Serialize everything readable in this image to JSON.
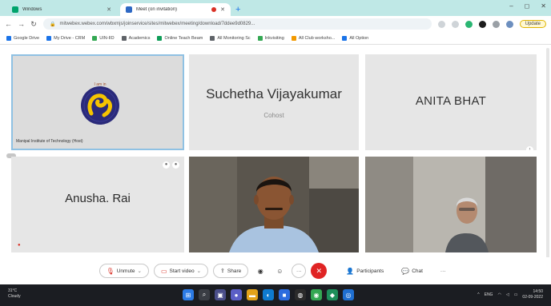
{
  "browser": {
    "tabs": [
      {
        "title": "Windows",
        "active": false,
        "fav_color": "#00a36c"
      },
      {
        "title": "Meet (on invitation)",
        "active": true,
        "fav_color": "#2d68c4"
      }
    ],
    "new_tab": "+",
    "window_controls": [
      "–",
      "◻",
      "✕"
    ],
    "url": "mitwebex.webex.com/wbxmjs/joinservice/sites/mitwebex/meeting/download/7ddee9d0829...",
    "update_label": "Update",
    "bookmarks": [
      {
        "label": "Google Drive",
        "color": "#1a73e8"
      },
      {
        "label": "My Drive - CRM",
        "color": "#1a73e8"
      },
      {
        "label": "UIN-IID",
        "color": "#34a853"
      },
      {
        "label": "Academics",
        "color": "#5f6368"
      },
      {
        "label": "Online Teach Beam",
        "color": "#0f9d58"
      },
      {
        "label": "All Monitoring Sc",
        "color": "#5f6368"
      },
      {
        "label": "Inkvisiting",
        "color": "#34a853"
      },
      {
        "label": "All Club worksho...",
        "color": "#f29900"
      },
      {
        "label": "All Option",
        "color": "#1a73e8"
      }
    ]
  },
  "meeting": {
    "participants": [
      {
        "name": "",
        "caption": "Manipal Institute of Technology (Host)",
        "logo_text": "I am in"
      },
      {
        "name": "Suchetha Vijayakumar",
        "subtitle": "Cohost"
      },
      {
        "name": "ANITA BHAT"
      },
      {
        "name": "Anusha. Rai"
      },
      {
        "name": ""
      },
      {
        "name": ""
      }
    ]
  },
  "controls": {
    "unmute": "Unmute",
    "start_video": "Start video",
    "share": "Share",
    "participants": "Participants",
    "chat": "Chat",
    "more": "···",
    "leave": "✕"
  },
  "taskbar": {
    "weather_temp": "31°C",
    "weather_desc": "Cloudy",
    "lang": "ENG",
    "time": "14:50",
    "date": "02-09-2022"
  },
  "colors": {
    "accent": "#1a73e8",
    "leave_red": "#e02424",
    "tile_bg": "#e6e6e6",
    "tabstrip": "#bfe8e6"
  }
}
